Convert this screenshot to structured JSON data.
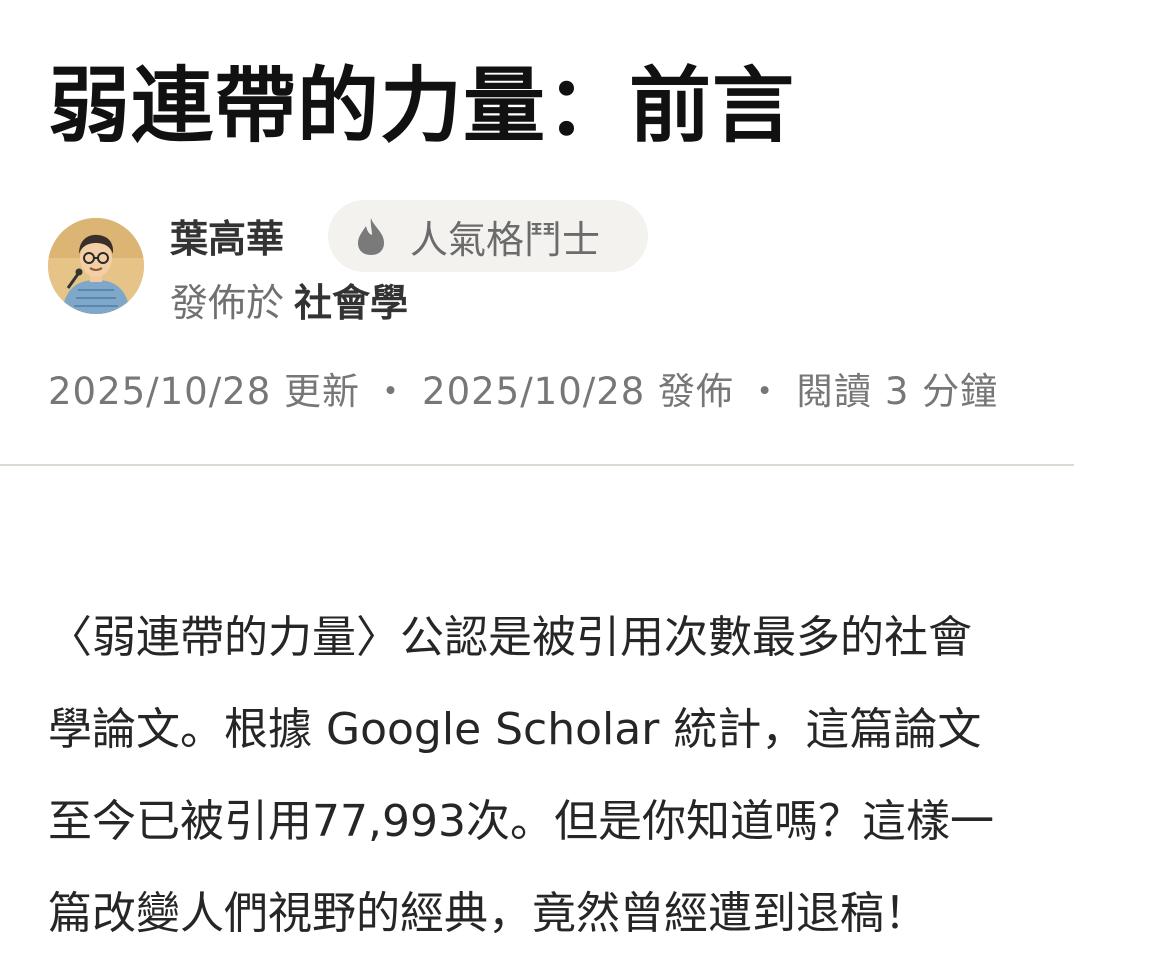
{
  "article": {
    "title": "弱連帶的力量：前言",
    "author": {
      "name": "葉高華",
      "avatar_icon": "avatar-portrait",
      "badge": {
        "icon": "flame-icon",
        "label": "人氣格鬥士"
      },
      "publish_prefix": "發佈於",
      "channel": "社會學"
    },
    "meta": {
      "updated": "2025/10/28 更新",
      "published": "2025/10/28 發佈",
      "reading_time": "閱讀 3 分鐘",
      "separator": "・"
    },
    "body_lines": [
      "〈弱連帶的力量〉公認是被引用次數最多的社會",
      "學論文。根據 Google Scholar 統計，這篇論文",
      "至今已被引用77,993次。但是你知道嗎？這樣一",
      "篇改變人們視野的經典，竟然曾經遭到退稿！"
    ]
  },
  "colors": {
    "title": "#111111",
    "badge_background": "#f3f2ef",
    "meta_text": "#777777",
    "divider": "#dcd9d2"
  }
}
